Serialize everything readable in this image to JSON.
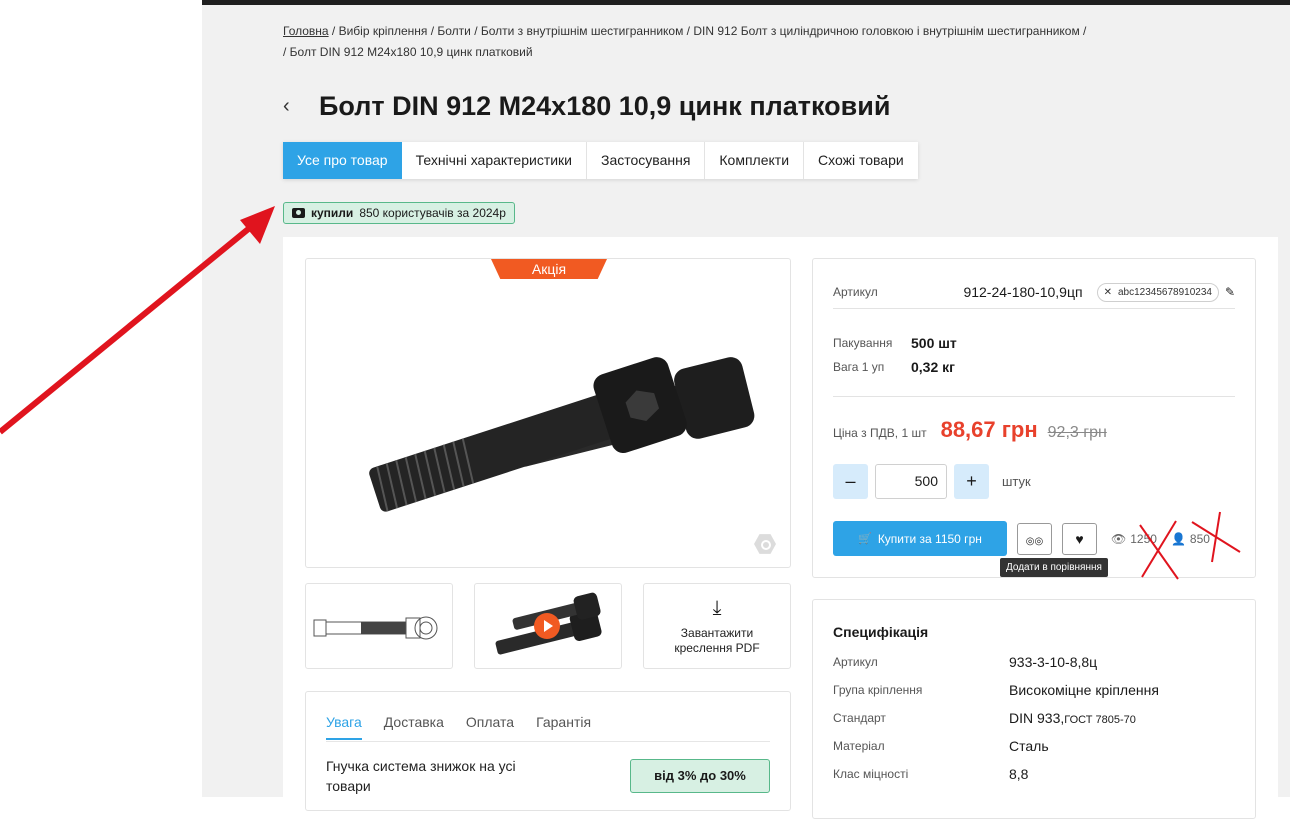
{
  "breadcrumb": {
    "home": "Головна",
    "rest_line1": " / Вибір кріплення / Болти / Болти з внутрішнім шестигранником / DIN 912 Болт з циліндричною головкою і внутрішнім шестигранником /",
    "line2": "/ Болт DIN 912 M24x180 10,9 цинк платковий"
  },
  "back_icon": "‹",
  "title": "Болт DIN 912 M24x180 10,9 цинк платковий",
  "tabs": [
    {
      "label": "Усе про товар",
      "active": true
    },
    {
      "label": "Технічні характеристики"
    },
    {
      "label": "Застосування"
    },
    {
      "label": "Комплекти"
    },
    {
      "label": "Схожі товари"
    }
  ],
  "bought_badge": {
    "strong": "купили",
    "text": "850 користувачів за 2024р",
    "icon": "camera-icon"
  },
  "gallery": {
    "promo_label": "Акція"
  },
  "thumbs": {
    "download_label": "Завантажити креслення PDF",
    "download_icon": "⤓"
  },
  "info_tabs": {
    "items": [
      "Увага",
      "Доставка",
      "Оплата",
      "Гарантія"
    ],
    "active": "Увага",
    "discount_text": "Гнучка система знижок на усі товари",
    "discount_badge": "від 3% до 30%"
  },
  "buybox": {
    "sku_label": "Артикул",
    "sku_value": "912-24-180-10,9цп",
    "sku_chip": "abc12345678910234",
    "sku_chip_close": "✕",
    "pencil_icon": "✎",
    "pack_label": "Пакування",
    "pack_value": "500 шт",
    "weight_label": "Вага 1 уп",
    "weight_value": "0,32 кг",
    "price_label": "Ціна з ПДВ, 1 шт",
    "price_new": "88,67 грн",
    "price_old": "92,3 грн",
    "qty_minus": "–",
    "qty_value": "500",
    "qty_plus": "+",
    "qty_unit": "штук",
    "buy_label": "Купити за 1150 грн",
    "cart_icon": "🛒",
    "compare_icon": "◎◎",
    "heart_icon": "♥",
    "views_icon": "👁",
    "views": "1250",
    "users_icon": "👤",
    "users": "850",
    "tooltip": "Додати в порівняння"
  },
  "spec": {
    "title": "Специфікація",
    "rows": [
      {
        "label": "Артикул",
        "value": "933-3-10-8,8ц"
      },
      {
        "label": "Група кріплення",
        "value": "Високоміцне кріплення"
      },
      {
        "label": "Стандарт",
        "value": "DIN 933,",
        "extra": "ГОСТ 7805-70"
      },
      {
        "label": "Матеріал",
        "value": "Сталь"
      },
      {
        "label": "Клас міцності",
        "value": "8,8"
      }
    ]
  },
  "colors": {
    "accent": "#2ea3e6",
    "promo": "#f15a22",
    "price": "#e8412c",
    "annotation": "#e0141e"
  }
}
